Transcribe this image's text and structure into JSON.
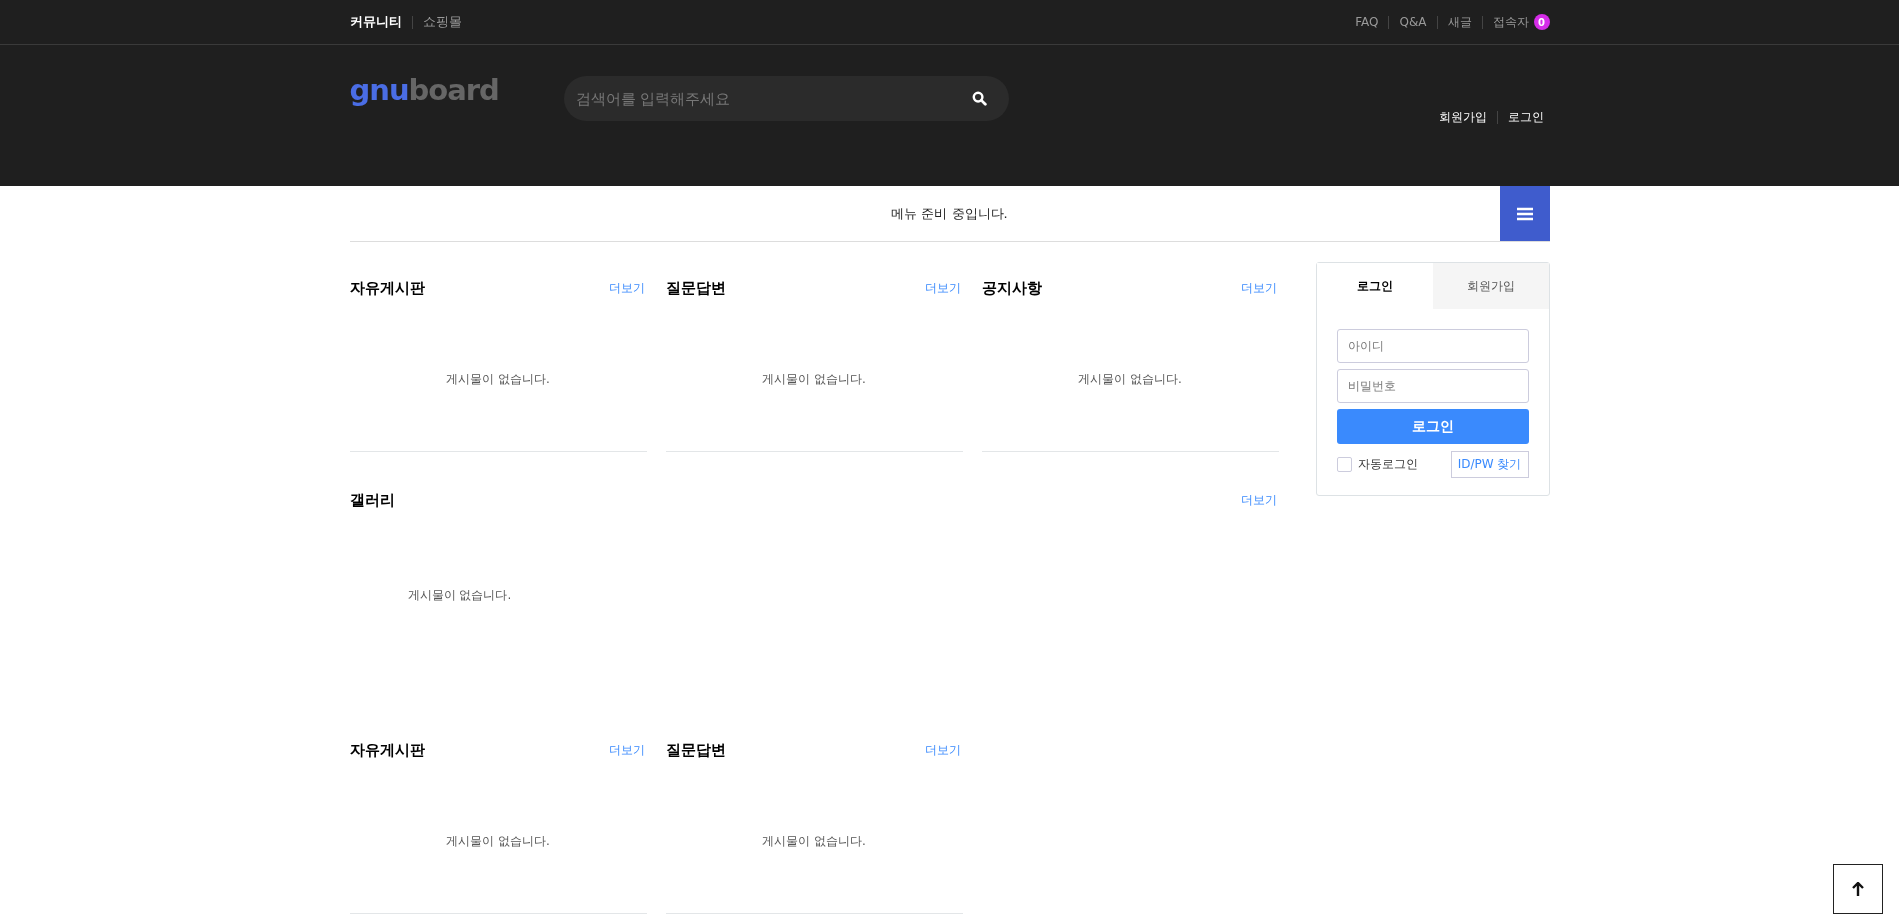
{
  "top_bar": {
    "left_links": [
      {
        "label": "커뮤니티",
        "selected": true
      },
      {
        "label": "쇼핑몰",
        "selected": false
      }
    ],
    "right_links": [
      {
        "label": "FAQ"
      },
      {
        "label": "Q&A"
      },
      {
        "label": "새글"
      },
      {
        "label": "접속자"
      }
    ],
    "visitor_count": "0"
  },
  "header": {
    "logo": {
      "accent": "gnu",
      "rest": "board"
    },
    "search": {
      "placeholder": "검색어를 입력해주세요"
    },
    "member_links": [
      {
        "label": "회원가입"
      },
      {
        "label": "로그인"
      }
    ]
  },
  "menu_bar": {
    "notice": "메뉴 준비 중입니다."
  },
  "boards": [
    {
      "kind": "list",
      "title": "자유게시판",
      "more": "더보기",
      "empty": "게시물이 없습니다."
    },
    {
      "kind": "list",
      "title": "질문답변",
      "more": "더보기",
      "empty": "게시물이 없습니다."
    },
    {
      "kind": "list",
      "title": "공지사항",
      "more": "더보기",
      "empty": "게시물이 없습니다."
    },
    {
      "kind": "gallery",
      "title": "갤러리",
      "more": "더보기",
      "empty": "게시물이 없습니다."
    },
    {
      "kind": "list",
      "title": "자유게시판",
      "more": "더보기",
      "empty": "게시물이 없습니다."
    },
    {
      "kind": "list",
      "title": "질문답변",
      "more": "더보기",
      "empty": "게시물이 없습니다."
    }
  ],
  "login_box": {
    "tabs": [
      {
        "label": "로그인",
        "selected": true
      },
      {
        "label": "회원가입",
        "selected": false
      }
    ],
    "id_field": {
      "placeholder": "아이디"
    },
    "password_field": {
      "placeholder": "비밀번호"
    },
    "submit": "로그인",
    "auto_login": {
      "label": "자동로그인",
      "checked": false
    },
    "find_account": "ID/PW 찾기"
  }
}
